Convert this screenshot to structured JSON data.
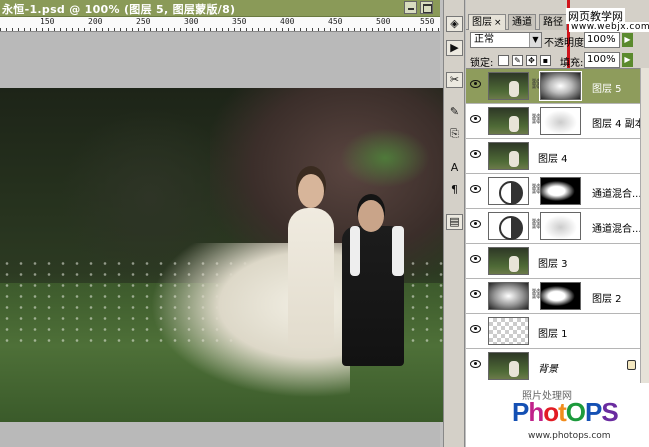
{
  "document": {
    "title": "永恒-1.psd @ 100% (图层 5, 图层蒙版/8)",
    "ruler_labels": [
      "150",
      "200",
      "250",
      "300",
      "350",
      "400",
      "450",
      "500",
      "550"
    ]
  },
  "watermark": {
    "site": "网页教学网",
    "url": "www.webjx.com"
  },
  "panel": {
    "tabs": [
      {
        "label": "图层",
        "close": "×"
      },
      {
        "label": "通道"
      },
      {
        "label": "路径"
      }
    ],
    "blend_mode": "正常",
    "opacity_label": "不透明度:",
    "opacity_value": "100%",
    "lock_label": "锁定:",
    "fill_label": "填充:",
    "fill_value": "100%",
    "flyout": "▶"
  },
  "layers": [
    {
      "name": "图层 5",
      "selected": true
    },
    {
      "name": "图层 4 副本",
      "selected": false
    },
    {
      "name": "图层 4",
      "selected": false
    },
    {
      "name": "通道混合...",
      "selected": false
    },
    {
      "name": "通道混合...",
      "selected": false
    },
    {
      "name": "图层 3",
      "selected": false
    },
    {
      "name": "图层 2",
      "selected": false
    },
    {
      "name": "图层 1",
      "selected": false
    },
    {
      "name": "背景",
      "selected": false,
      "locked": true
    }
  ],
  "branding": {
    "top": "照片处理网",
    "logo": [
      "P",
      "h",
      "o",
      "t",
      "O",
      "P",
      "S"
    ],
    "url": "www.photops.com"
  },
  "colors": {
    "selected_layer": "#8e9c5c",
    "title_bar": "#8a9a58",
    "arrow": "#d0141c"
  }
}
